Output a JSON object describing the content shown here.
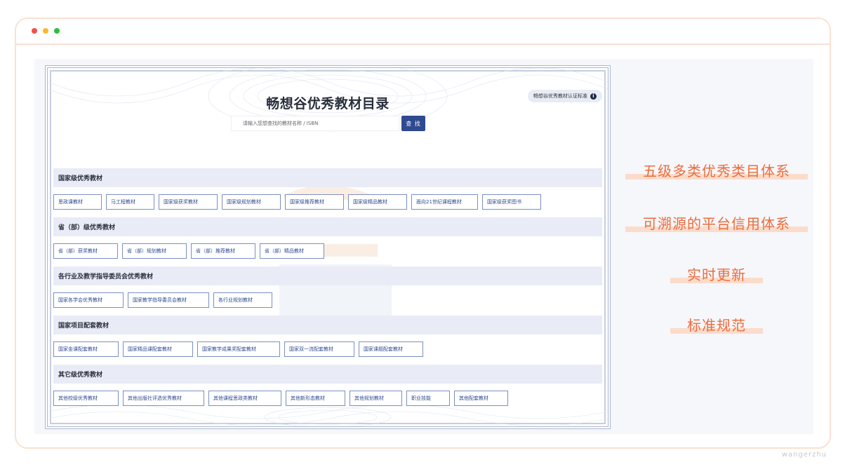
{
  "window": {
    "controls": [
      "close",
      "minimize",
      "maximize"
    ]
  },
  "catalog": {
    "title": "畅想谷优秀教材目录",
    "standard_badge": "畅想谷优秀教材认证标准",
    "search": {
      "placeholder": "请输入您想查找的教材名称 / ISBN",
      "button_label": "查 找"
    },
    "sections": [
      {
        "title": "国家级优秀教材",
        "items": [
          "思政课教材",
          "马工程教材",
          "国家级获奖教材",
          "国家级规划教材",
          "国家级推荐教材",
          "国家级精品教材",
          "面向21世纪课程教材",
          "国家级获奖图书"
        ]
      },
      {
        "title": "省（部）级优秀教材",
        "items": [
          "省（部）获奖教材",
          "省（部）规划教材",
          "省（部）推荐教材",
          "省（部）精品教材"
        ]
      },
      {
        "title": "各行业及教学指导委员会优秀教材",
        "items": [
          "国家各学会优秀教材",
          "国家教学指导委员会教材",
          "各行业规划教材"
        ]
      },
      {
        "title": "国家项目配套教材",
        "items": [
          "国家金课配套教材",
          "国家精品课配套教材",
          "国家教学成果奖配套教材",
          "国家双一流配套教材",
          "国家课题配套教材"
        ]
      },
      {
        "title": "其它级优秀教材",
        "items": [
          "其他校级优秀教材",
          "其他出版社评选优秀教材",
          "其他课程思政类教材",
          "其他新形态教材",
          "其他规划教材",
          "职业技能",
          "其他配套教材"
        ]
      }
    ]
  },
  "features": [
    "五级多类优秀类目体系",
    "可溯源的平台信用体系",
    "实时更新",
    "标准规范"
  ],
  "colors": {
    "accent_orange": "#ef6a3a",
    "primary_blue": "#2f4a8f",
    "frame_border": "#fbe0d2"
  },
  "watermark": "wangerzhu"
}
